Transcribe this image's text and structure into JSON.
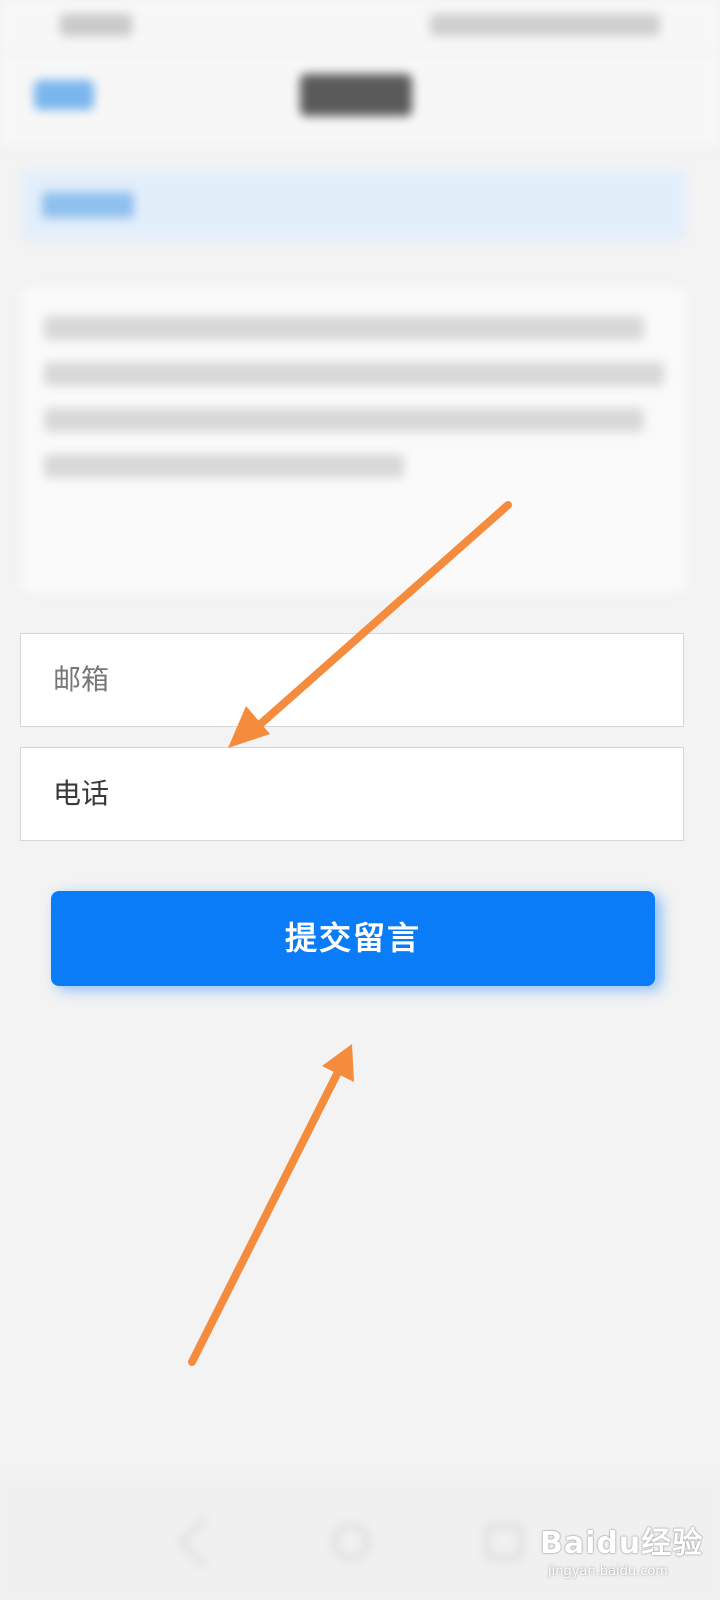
{
  "form": {
    "email_placeholder": "邮箱",
    "phone_placeholder": "电话",
    "submit_label": "提交留言"
  },
  "annotations": {
    "arrow_color": "#f58b3c"
  },
  "colors": {
    "primary": "#0a7cf8",
    "background": "#f3f3f3"
  },
  "watermark": {
    "brand": "Baidu经验",
    "url": "jingyan.baidu.com"
  }
}
